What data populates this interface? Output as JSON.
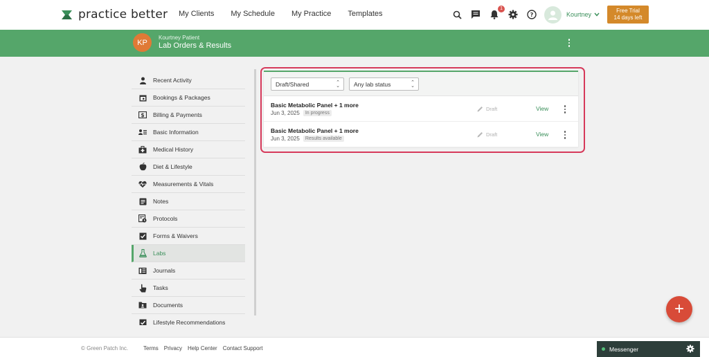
{
  "app": {
    "logo_text": "practice better"
  },
  "nav": {
    "links": [
      "My Clients",
      "My Schedule",
      "My Practice",
      "Templates"
    ],
    "notification_count": "1",
    "user_name": "Kourtney",
    "trial_line1": "Free Trial",
    "trial_line2": "14 days left"
  },
  "patient": {
    "initials": "KP",
    "name": "Kourtney Patient",
    "page_title": "Lab Orders & Results"
  },
  "sidebar": {
    "items": [
      {
        "label": "Recent Activity",
        "icon": "person-icon"
      },
      {
        "label": "Bookings & Packages",
        "icon": "calendar-icon"
      },
      {
        "label": "Billing & Payments",
        "icon": "dollar-icon"
      },
      {
        "label": "Basic Information",
        "icon": "contact-icon"
      },
      {
        "label": "Medical History",
        "icon": "medkit-icon"
      },
      {
        "label": "Diet & Lifestyle",
        "icon": "apple-icon"
      },
      {
        "label": "Measurements & Vitals",
        "icon": "heartbeat-icon"
      },
      {
        "label": "Notes",
        "icon": "notes-icon"
      },
      {
        "label": "Protocols",
        "icon": "protocol-icon"
      },
      {
        "label": "Forms & Waivers",
        "icon": "checkbox-icon"
      },
      {
        "label": "Labs",
        "icon": "flask-icon"
      },
      {
        "label": "Journals",
        "icon": "journal-icon"
      },
      {
        "label": "Tasks",
        "icon": "hand-icon"
      },
      {
        "label": "Documents",
        "icon": "folder-icon"
      },
      {
        "label": "Lifestyle Recommendations",
        "icon": "check-list-icon"
      }
    ],
    "active": "Labs"
  },
  "filters": {
    "type": "Draft/Shared",
    "status": "Any lab status"
  },
  "labs": [
    {
      "title": "Basic Metabolic Panel + 1 more",
      "date": "Jun 3, 2025",
      "status": "In progress",
      "draft": "Draft",
      "action": "View"
    },
    {
      "title": "Basic Metabolic Panel + 1 more",
      "date": "Jun 3, 2025",
      "status": "Results available",
      "draft": "Draft",
      "action": "View"
    }
  ],
  "fab_label": "+",
  "footer": {
    "copyright": "© Green Patch Inc.",
    "links": [
      "Terms",
      "Privacy",
      "Help Center",
      "Contact Support"
    ]
  },
  "messenger": {
    "label": "Messenger"
  },
  "colors": {
    "brand_green": "#55a66a",
    "accent_orange": "#d4892a",
    "fab_red": "#d84b38",
    "highlight": "#d6395a"
  }
}
